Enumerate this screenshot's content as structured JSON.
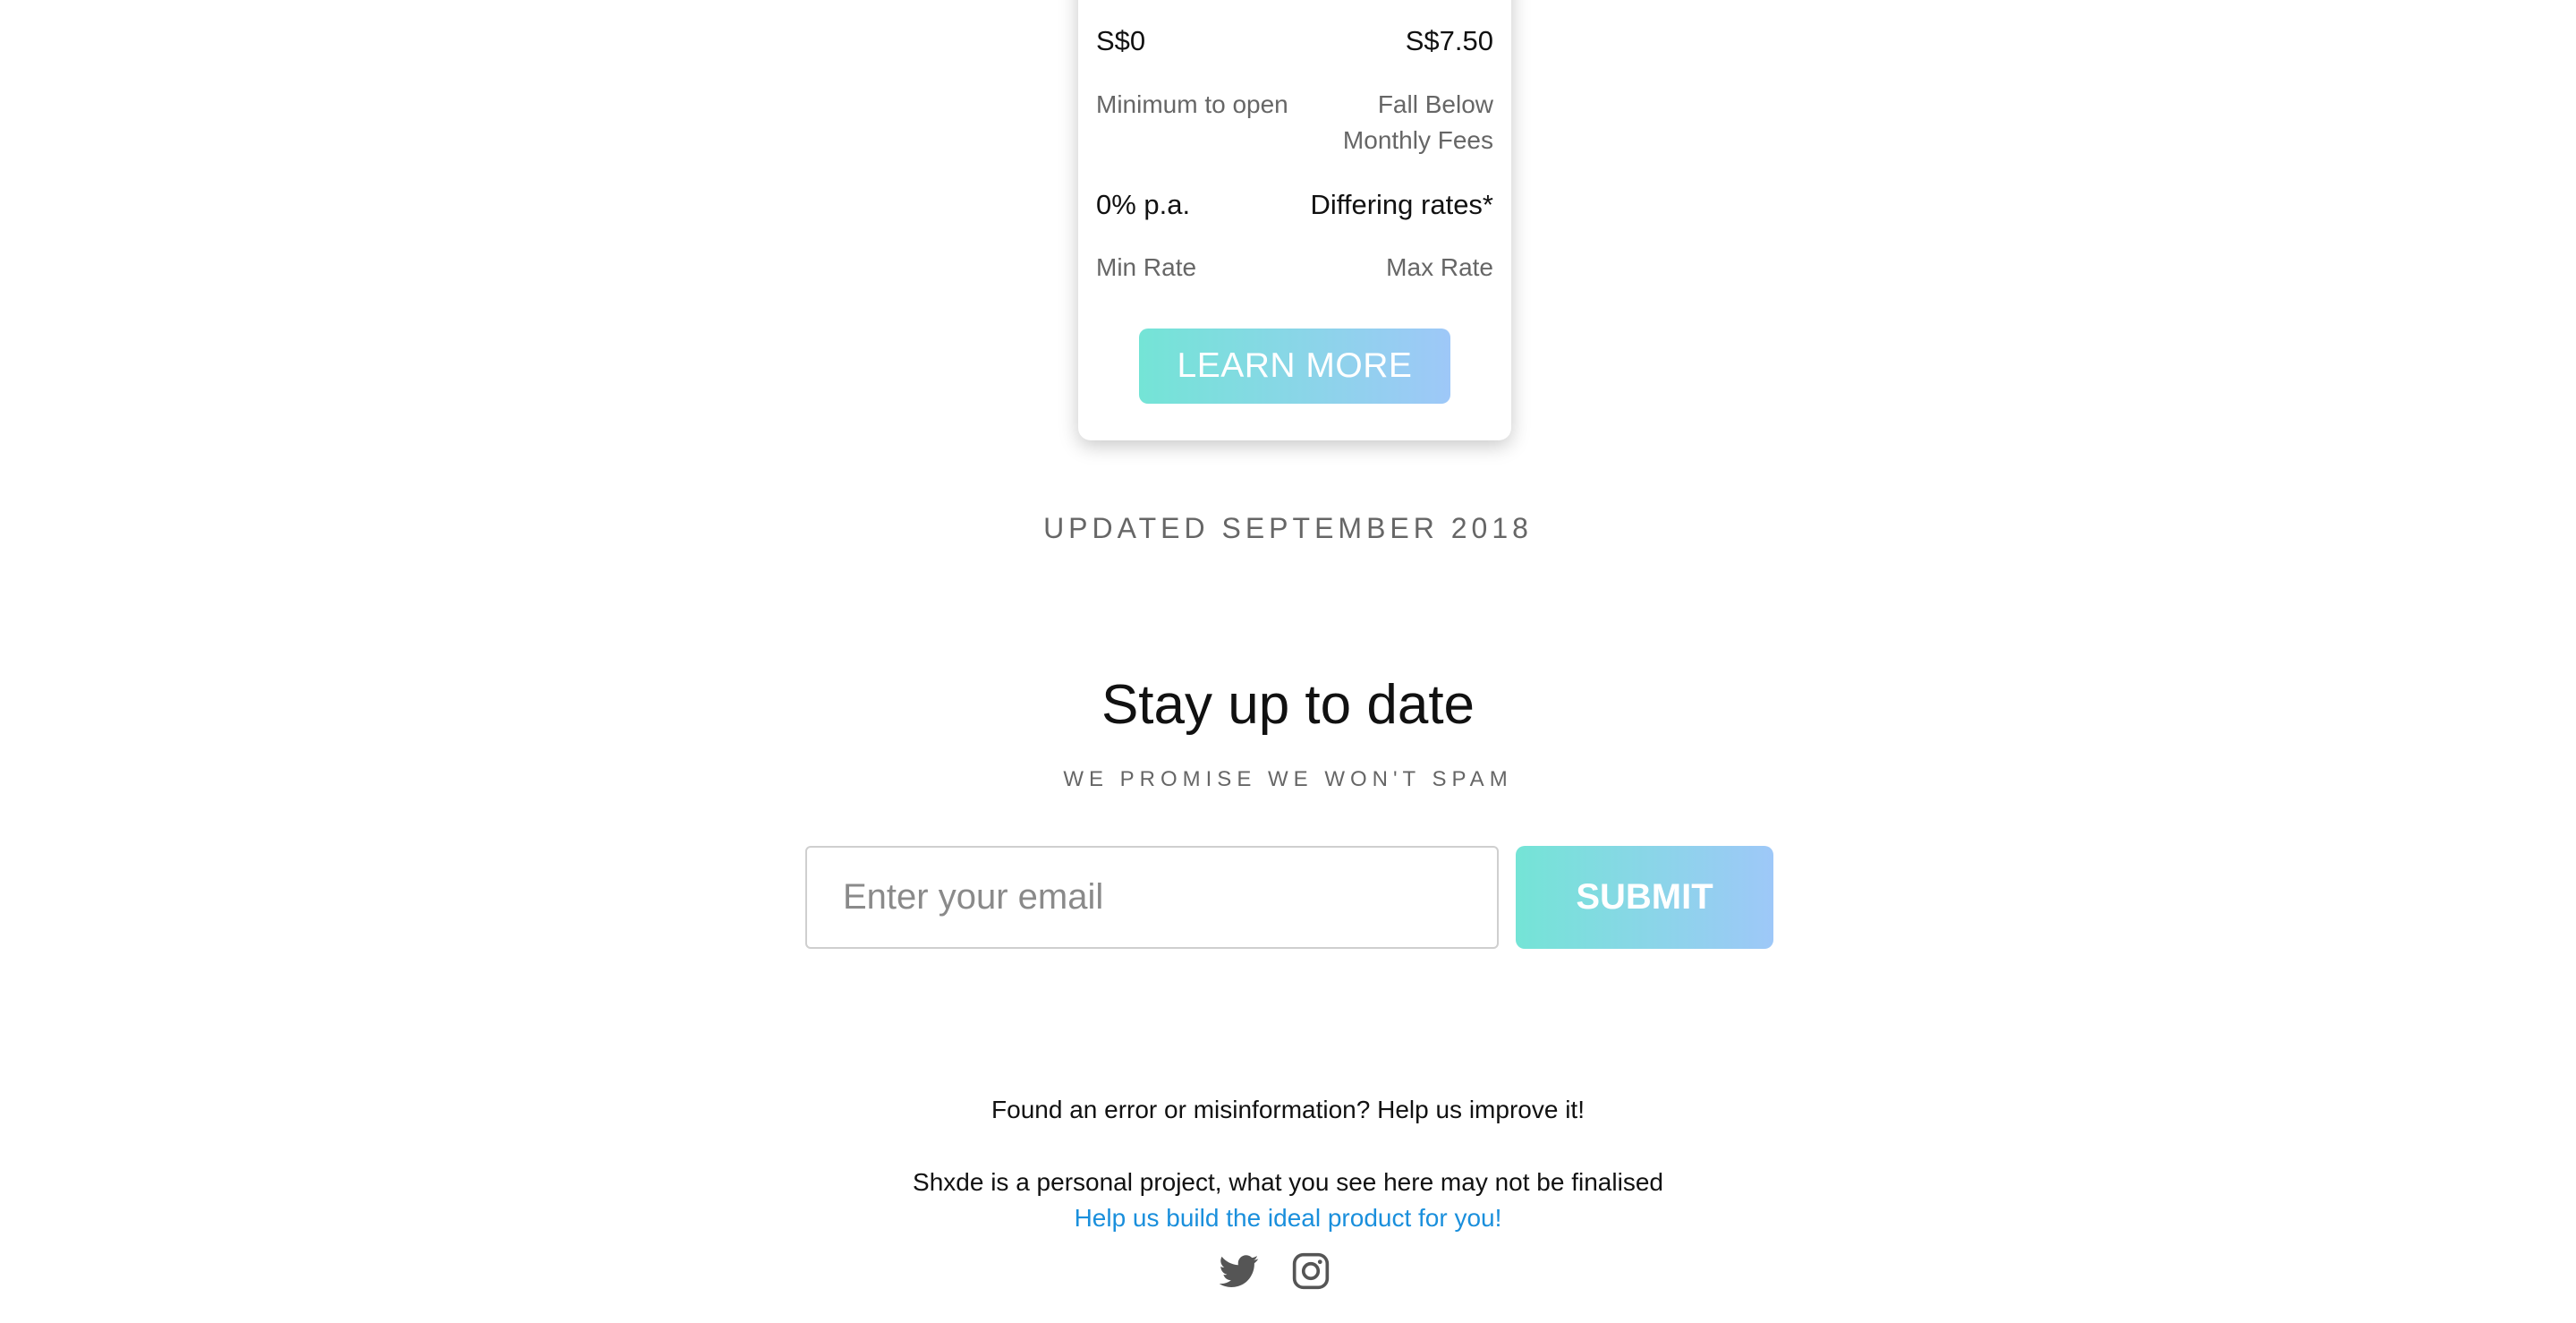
{
  "card": {
    "min_open_value": "S$0",
    "min_open_label": "Minimum to open",
    "fall_below_value": "S$7.50",
    "fall_below_label_line1": "Fall Below",
    "fall_below_label_line2": "Monthly Fees",
    "min_rate_value": "0% p.a.",
    "min_rate_label": "Min Rate",
    "max_rate_value": "Differing rates*",
    "max_rate_label": "Max Rate",
    "learn_more_label": "LEARN MORE"
  },
  "updated_text": "UPDATED SEPTEMBER 2018",
  "newsletter": {
    "title": "Stay up to date",
    "subtitle": "WE PROMISE WE WON'T SPAM",
    "email_placeholder": "Enter your email",
    "submit_label": "SUBMIT"
  },
  "footer": {
    "error_text": "Found an error or misinformation? Help us improve it!",
    "project_text": "Shxde is a personal project, what you see here may not be finalised",
    "help_link": "Help us build the ideal product for you!",
    "social_icons": [
      "twitter-icon",
      "instagram-icon"
    ]
  },
  "colors": {
    "button_gradient_start": "#74e4d6",
    "button_gradient_end": "#9ec8f8",
    "link": "#1a8fdc",
    "muted_text": "#666666"
  }
}
